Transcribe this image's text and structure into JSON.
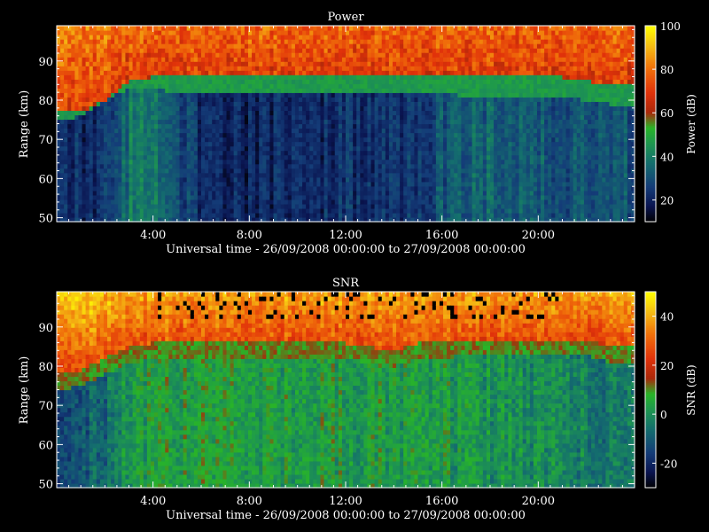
{
  "chart_data": [
    {
      "type": "heatmap",
      "title": "Power",
      "xlabel": "Universal time - 26/09/2008 00:00:00 to 27/09/2008 00:00:00",
      "ylabel": "Range (km)",
      "colorbar_label": "Power (dB)",
      "x_range_hours": [
        0,
        24
      ],
      "y_range_km": [
        49,
        99
      ],
      "x_ticks": [
        4,
        8,
        12,
        16,
        20
      ],
      "x_tick_labels": [
        "4:00",
        "8:00",
        "12:00",
        "16:00",
        "20:00"
      ],
      "y_ticks": [
        50,
        60,
        70,
        80,
        90
      ],
      "y_tick_labels": [
        "50",
        "60",
        "70",
        "80",
        "90"
      ],
      "color_range": [
        10,
        100
      ],
      "colorbar_ticks": [
        20,
        40,
        60,
        80,
        100
      ],
      "colorbar_tick_labels": [
        "20",
        "40",
        "60",
        "80",
        "100"
      ],
      "time_profile_hours": [
        0,
        1,
        2,
        3,
        4,
        5,
        6,
        7,
        8,
        9,
        10,
        11,
        12,
        13,
        14,
        15,
        16,
        17,
        18,
        19,
        20,
        21,
        22,
        23,
        24
      ],
      "upper_boundary_km": [
        77,
        77,
        80,
        85,
        86,
        86,
        86,
        86,
        86,
        86,
        86,
        86,
        86,
        86,
        86,
        86,
        86,
        86,
        86,
        86,
        86,
        86,
        85,
        84,
        84
      ],
      "mid_boundary_km": [
        75,
        76,
        80,
        83,
        83,
        82,
        82,
        82,
        82,
        82,
        82,
        82,
        82,
        82,
        82,
        82,
        82,
        81,
        81,
        81,
        81,
        81,
        80,
        79,
        79
      ],
      "low_region_level_db": [
        22,
        22,
        22,
        38,
        40,
        30,
        22,
        21,
        20,
        21,
        22,
        22,
        23,
        24,
        24,
        25,
        30,
        34,
        34,
        33,
        32,
        31,
        31,
        30,
        30
      ]
    },
    {
      "type": "heatmap",
      "title": "SNR",
      "xlabel": "Universal time - 26/09/2008 00:00:00 to 27/09/2008 00:00:00",
      "ylabel": "Range (km)",
      "colorbar_label": "SNR (dB)",
      "x_range_hours": [
        0,
        24
      ],
      "y_range_km": [
        49,
        99
      ],
      "x_ticks": [
        4,
        8,
        12,
        16,
        20
      ],
      "x_tick_labels": [
        "4:00",
        "8:00",
        "12:00",
        "16:00",
        "20:00"
      ],
      "y_ticks": [
        50,
        60,
        70,
        80,
        90
      ],
      "y_tick_labels": [
        "50",
        "60",
        "70",
        "80",
        "90"
      ],
      "color_range": [
        -30,
        50
      ],
      "colorbar_ticks": [
        -20,
        0,
        20,
        40
      ],
      "colorbar_tick_labels": [
        "-20",
        "0",
        "20",
        "40"
      ],
      "time_profile_hours": [
        0,
        1,
        2,
        3,
        4,
        5,
        6,
        7,
        8,
        9,
        10,
        11,
        12,
        13,
        14,
        15,
        16,
        17,
        18,
        19,
        20,
        21,
        22,
        23,
        24
      ],
      "upper_boundary_km": [
        77,
        78,
        81,
        84,
        85,
        85,
        85,
        85,
        85,
        85,
        85,
        85,
        85,
        84,
        83,
        85,
        85,
        86,
        86,
        86,
        86,
        86,
        86,
        84,
        84
      ],
      "low_region_level_db": [
        -12,
        -10,
        -8,
        2,
        4,
        5,
        5,
        4,
        4,
        4,
        4,
        4,
        4,
        4,
        4,
        4,
        3,
        2,
        1,
        0,
        -1,
        -2,
        -3,
        -4,
        -5
      ]
    }
  ]
}
